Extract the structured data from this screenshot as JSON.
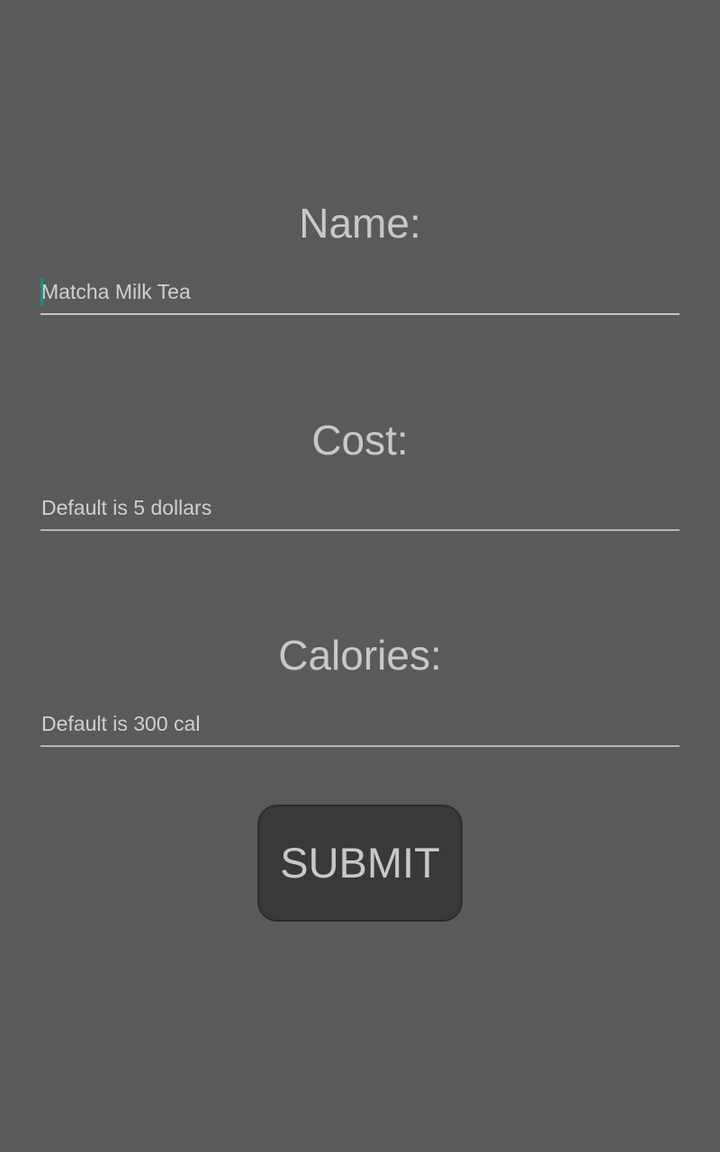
{
  "form": {
    "name": {
      "label": "Name:",
      "value": "Matcha Milk Tea",
      "placeholder": ""
    },
    "cost": {
      "label": "Cost:",
      "value": "",
      "placeholder": "Default is 5 dollars"
    },
    "calories": {
      "label": "Calories:",
      "value": "",
      "placeholder": "Default is 300 cal"
    },
    "submit_label": "SUBMIT"
  },
  "colors": {
    "background": "#5a5a5a",
    "text": "#c8c8c8",
    "accent": "#1e8c7e",
    "button": "#393939"
  }
}
